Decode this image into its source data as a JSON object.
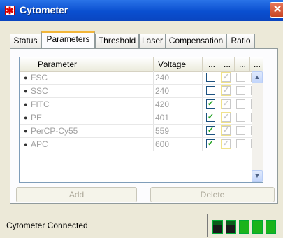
{
  "window": {
    "title": "Cytometer",
    "close_glyph": "✕",
    "icon_glyph": "✱"
  },
  "tabs": [
    {
      "label": "Status",
      "active": false
    },
    {
      "label": "Parameters",
      "active": true
    },
    {
      "label": "Threshold",
      "active": false
    },
    {
      "label": "Laser",
      "active": false
    },
    {
      "label": "Compensation",
      "active": false
    },
    {
      "label": "Ratio",
      "active": false
    }
  ],
  "grid": {
    "headers": {
      "parameter": "Parameter",
      "voltage": "Voltage",
      "c1": "...",
      "c2": "...",
      "c3": "...",
      "c4": "..."
    },
    "rows": [
      {
        "marker": "●",
        "name": "FSC",
        "voltage": "240",
        "checks": [
          false,
          true,
          false,
          false
        ]
      },
      {
        "marker": "●",
        "name": "SSC",
        "voltage": "240",
        "checks": [
          false,
          true,
          false,
          false
        ]
      },
      {
        "marker": "●",
        "name": "FITC",
        "voltage": "420",
        "checks": [
          true,
          true,
          false,
          false
        ]
      },
      {
        "marker": "●",
        "name": "PE",
        "voltage": "401",
        "checks": [
          true,
          true,
          false,
          false
        ]
      },
      {
        "marker": "●",
        "name": "PerCP-Cy55",
        "voltage": "559",
        "checks": [
          true,
          true,
          false,
          false
        ]
      },
      {
        "marker": "●",
        "name": "APC",
        "voltage": "600",
        "checks": [
          true,
          true,
          false,
          false
        ]
      }
    ],
    "scroll_up_glyph": "▲",
    "scroll_down_glyph": "▼"
  },
  "buttons": {
    "add": "Add",
    "delete": "Delete"
  },
  "status": {
    "text": "Cytometer Connected",
    "leds": [
      true,
      true,
      false,
      false,
      false
    ]
  },
  "check_glyph": "✓",
  "colors": {
    "title_bar": "#0a4fd0",
    "tab_highlight": "#f2b63a",
    "led_green": "#1bb31b"
  }
}
